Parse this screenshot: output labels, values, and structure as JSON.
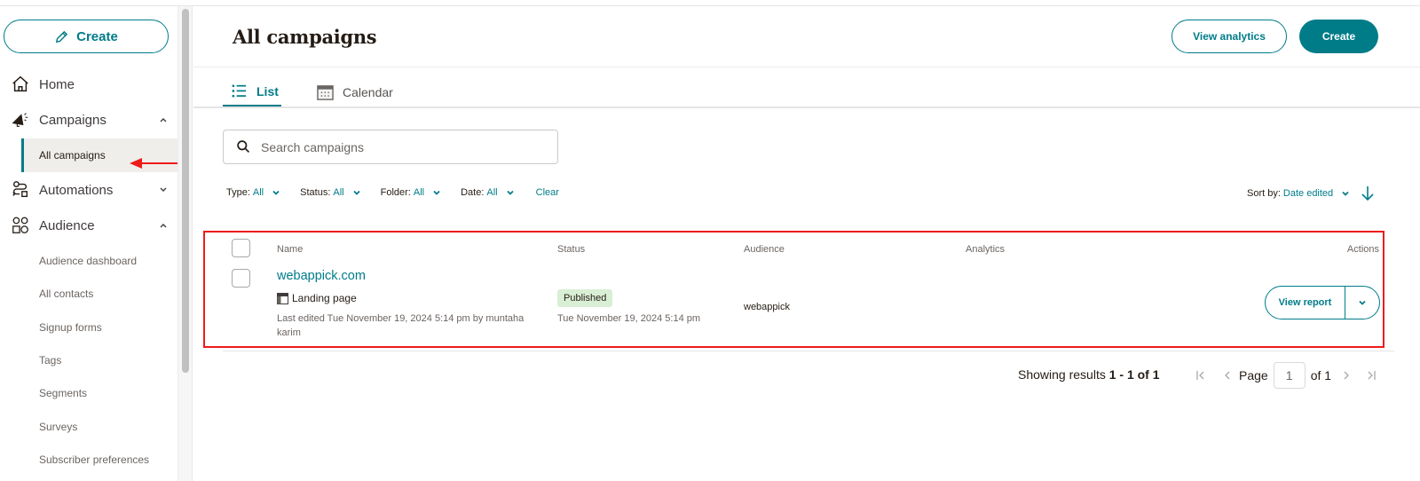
{
  "colors": {
    "brand": "#007c89",
    "annotation": "#ee1b1b",
    "badge_bg": "#d9efd5"
  },
  "sidebar": {
    "create_label": "Create",
    "nav": [
      {
        "label": "Home",
        "icon": "home-icon"
      },
      {
        "label": "Campaigns",
        "icon": "megaphone-icon",
        "expanded": true
      },
      {
        "label": "Automations",
        "icon": "automations-icon",
        "expanded": false
      },
      {
        "label": "Audience",
        "icon": "audience-icon",
        "expanded": true
      }
    ],
    "campaigns_sub": [
      {
        "label": "All campaigns",
        "active": true
      }
    ],
    "audience_sub": [
      {
        "label": "Audience dashboard"
      },
      {
        "label": "All contacts"
      },
      {
        "label": "Signup forms"
      },
      {
        "label": "Tags"
      },
      {
        "label": "Segments"
      },
      {
        "label": "Surveys"
      },
      {
        "label": "Subscriber preferences"
      }
    ]
  },
  "header": {
    "title": "All campaigns",
    "view_analytics_label": "View analytics",
    "create_label": "Create"
  },
  "tabs": [
    {
      "label": "List",
      "icon": "list-icon",
      "active": true
    },
    {
      "label": "Calendar",
      "icon": "calendar-icon",
      "active": false
    }
  ],
  "search": {
    "placeholder": "Search campaigns",
    "value": ""
  },
  "filters": [
    {
      "key": "Type:",
      "value": "All"
    },
    {
      "key": "Status:",
      "value": "All"
    },
    {
      "key": "Folder:",
      "value": "All"
    },
    {
      "key": "Date:",
      "value": "All"
    }
  ],
  "clear_label": "Clear",
  "sort": {
    "key": "Sort by:",
    "value": "Date edited",
    "direction": "descending"
  },
  "table": {
    "columns": [
      "Name",
      "Status",
      "Audience",
      "Analytics",
      "Actions"
    ],
    "rows": [
      {
        "name": "webappick.com",
        "type": "Landing page",
        "last_edited": "Last edited Tue November 19, 2024 5:14 pm by muntaha karim",
        "status": "Published",
        "status_date": "Tue November 19, 2024 5:14 pm",
        "audience": "webappick",
        "analytics": "",
        "action_label": "View report"
      }
    ]
  },
  "pagination": {
    "showing_prefix": "Showing results",
    "showing_range": "1 - 1 of 1",
    "page_label": "Page",
    "current_page": "1",
    "of_label": "of 1"
  }
}
